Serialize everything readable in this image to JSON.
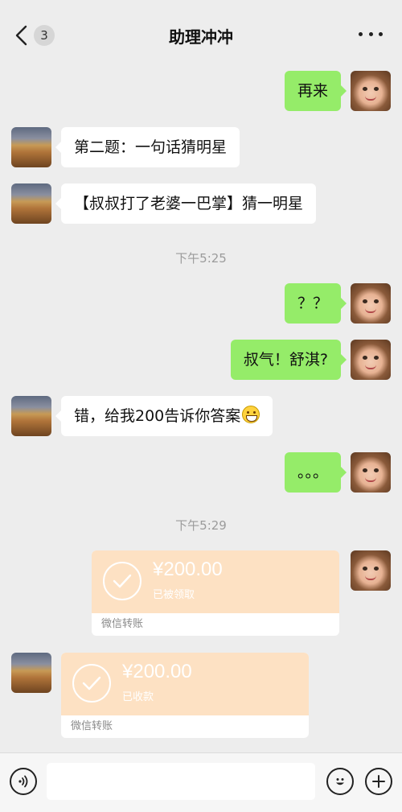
{
  "header": {
    "back_badge": "3",
    "title": "助理冲冲"
  },
  "messages": [
    {
      "side": "right",
      "text": "再来"
    },
    {
      "side": "left",
      "text": "第二题：一句话猜明星"
    },
    {
      "side": "left",
      "text": "【叔叔打了老婆一巴掌】猜一明星"
    },
    {
      "type": "time",
      "text": "下午5:25"
    },
    {
      "side": "right",
      "text": "？？"
    },
    {
      "side": "right",
      "text": "叔气！舒淇?"
    },
    {
      "side": "left",
      "text": "错，给我200告诉你答案",
      "emoji": "grin-emoji"
    },
    {
      "side": "right",
      "text": "。。。"
    },
    {
      "type": "time",
      "text": "下午5:29"
    }
  ],
  "transfers": [
    {
      "side": "right",
      "amount": "¥200.00",
      "status": "已被领取",
      "footer": "微信转账"
    },
    {
      "side": "left",
      "amount": "¥200.00",
      "status": "已收款",
      "footer": "微信转账"
    }
  ],
  "colors": {
    "background": "#ededed",
    "bubble_self": "#95ec69",
    "bubble_other": "#ffffff",
    "transfer_card": "#fde1c3"
  },
  "input_bar": {
    "voice_icon": "voice-icon",
    "emoji_icon": "emoji-icon",
    "plus_icon": "plus-icon"
  }
}
